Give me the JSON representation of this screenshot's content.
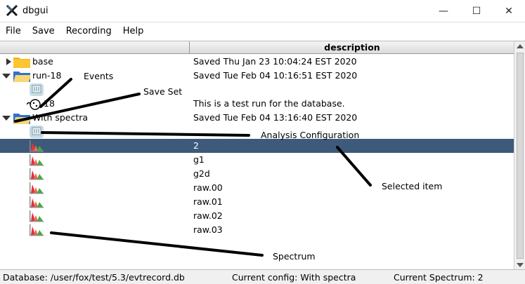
{
  "window": {
    "title": "dbgui",
    "minimize": "—",
    "maximize": "☐",
    "close": "✕"
  },
  "menu": [
    "File",
    "Save",
    "Recording",
    "Help"
  ],
  "header": {
    "col2": "description"
  },
  "tree": [
    {
      "name": "base",
      "desc": "Saved Thu Jan 23 10:04:24 EST 2020"
    },
    {
      "name": "run-18",
      "desc": "Saved Tue Feb 04 10:16:51 EST 2020"
    },
    {
      "name": "",
      "desc": ""
    },
    {
      "name": "18",
      "desc": "This is a test run for the database."
    },
    {
      "name": "With spectra",
      "desc": "Saved Tue Feb 04 13:16:40 EST 2020"
    },
    {
      "name": "",
      "desc": ""
    },
    {
      "name": "",
      "desc": "2"
    },
    {
      "name": "",
      "desc": "g1"
    },
    {
      "name": "",
      "desc": "g2d"
    },
    {
      "name": "",
      "desc": "raw.00"
    },
    {
      "name": "",
      "desc": "raw.01"
    },
    {
      "name": "",
      "desc": "raw.02"
    },
    {
      "name": "",
      "desc": "raw.03"
    }
  ],
  "annotations": {
    "events": "Events",
    "save_set": "Save Set",
    "analysis_configuration": "Analysis Configuration",
    "selected_item": "Selected item",
    "spectrum": "Spectrum"
  },
  "status": {
    "database": "Database:  /user/fox/test/5.3/evtrecord.db",
    "config": "Current config:  With spectra",
    "spectrum": "Current Spectrum:  2"
  },
  "colors": {
    "selection": "#3d5a7a",
    "folder": "#f5b71d",
    "folder_blue": "#2f6fd6"
  }
}
